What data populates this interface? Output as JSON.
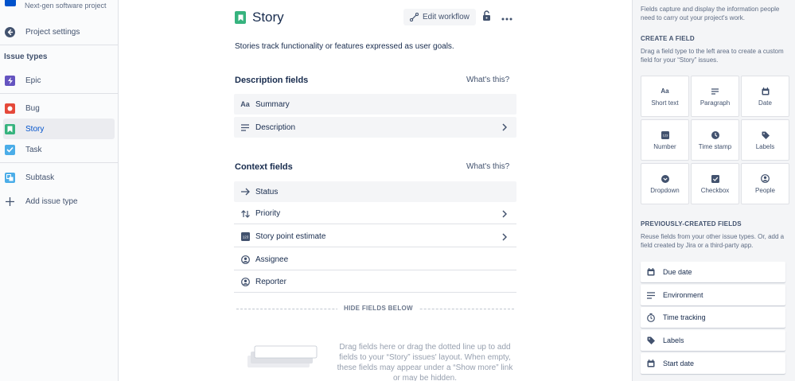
{
  "sidebar": {
    "project_subtitle": "Next-gen software project",
    "back_label": "Project settings",
    "issue_types_heading": "Issue types",
    "items": [
      {
        "label": "Epic"
      },
      {
        "label": "Bug"
      },
      {
        "label": "Story"
      },
      {
        "label": "Task"
      },
      {
        "label": "Subtask"
      }
    ],
    "add_label": "Add issue type",
    "colors": {
      "epic": "#6554C0",
      "bug": "#E5493A",
      "story": "#36B37E",
      "task": "#4BADE8",
      "subtask": "#4BADE8"
    }
  },
  "main": {
    "title": "Story",
    "edit_workflow_label": "Edit workflow",
    "description": "Stories track functionality or features expressed as user goals.",
    "description_section": {
      "title": "Description fields",
      "whats_this": "What's this?",
      "fields": [
        {
          "label": "Summary",
          "icon": "text-icon"
        },
        {
          "label": "Description",
          "icon": "paragraph-icon"
        }
      ]
    },
    "context_section": {
      "title": "Context fields",
      "whats_this": "What's this?",
      "fields": [
        {
          "label": "Status",
          "icon": "arrow-right-icon"
        },
        {
          "label": "Priority",
          "icon": "priority-icon"
        },
        {
          "label": "Story point estimate",
          "icon": "number-icon"
        },
        {
          "label": "Assignee",
          "icon": "person-icon"
        },
        {
          "label": "Reporter",
          "icon": "person-icon"
        }
      ]
    },
    "hide_fields_label": "HIDE FIELDS BELOW",
    "drag_text": "Drag fields here or drag the dotted line up to add fields to your “Story” issues' layout. When empty, these fields may appear under a “Show more” link or may be hidden."
  },
  "right_panel": {
    "intro": "Fields capture and display the information people need to carry out your project's work.",
    "create_heading": "CREATE A FIELD",
    "create_desc": "Drag a field type to the left area to create a custom field for your “Story” issues.",
    "field_types": [
      {
        "label": "Short text",
        "icon": "short-text-icon"
      },
      {
        "label": "Paragraph",
        "icon": "paragraph-icon"
      },
      {
        "label": "Date",
        "icon": "calendar-icon"
      },
      {
        "label": "Number",
        "icon": "number-icon"
      },
      {
        "label": "Time stamp",
        "icon": "clock-icon"
      },
      {
        "label": "Labels",
        "icon": "tag-icon"
      },
      {
        "label": "Dropdown",
        "icon": "dropdown-icon"
      },
      {
        "label": "Checkbox",
        "icon": "checkbox-icon"
      },
      {
        "label": "People",
        "icon": "person-icon"
      }
    ],
    "previous_heading": "PREVIOUSLY-CREATED FIELDS",
    "previous_desc": "Reuse fields from your other issue types. Or, add a field created by Jira or a third-party app.",
    "previous_fields": [
      {
        "label": "Due date",
        "icon": "calendar-icon"
      },
      {
        "label": "Environment",
        "icon": "paragraph-icon"
      },
      {
        "label": "Time tracking",
        "icon": "stopwatch-icon"
      },
      {
        "label": "Labels",
        "icon": "tag-icon"
      },
      {
        "label": "Start date",
        "icon": "calendar-icon"
      }
    ]
  }
}
